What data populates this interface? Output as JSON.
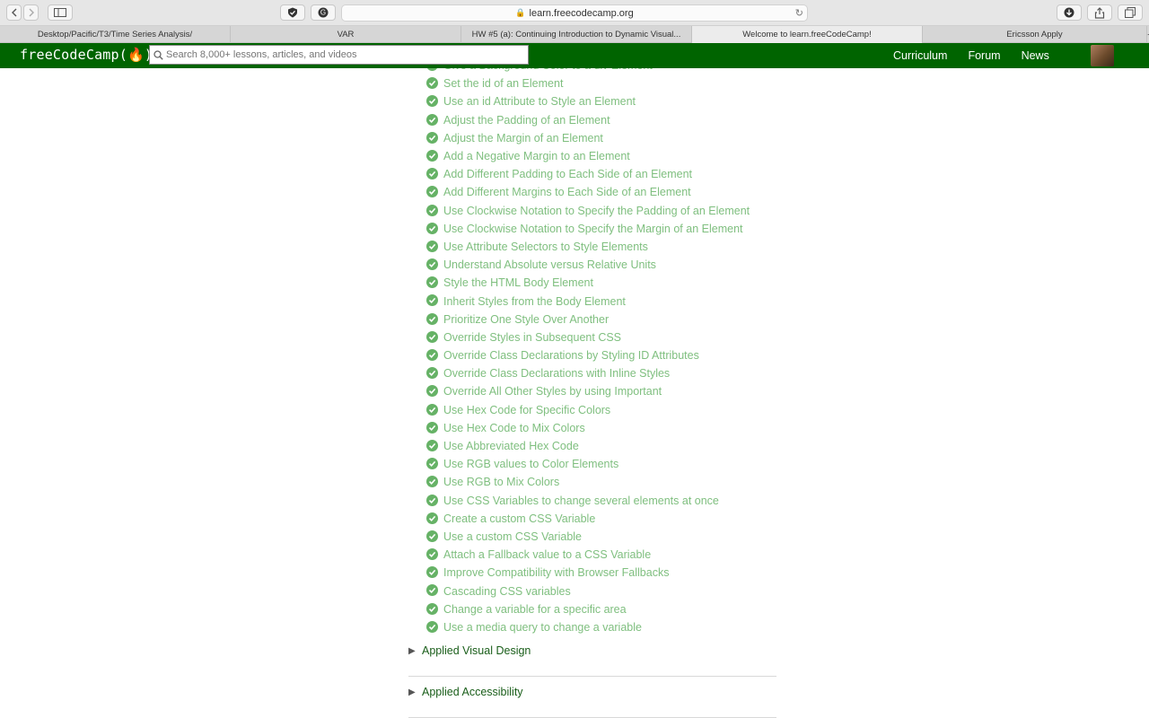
{
  "browser": {
    "url": "learn.freecodecamp.org",
    "tabs": [
      {
        "label": "Desktop/Pacific/T3/Time Series Analysis/",
        "active": false
      },
      {
        "label": "VAR",
        "active": false
      },
      {
        "label": "HW #5 (a): Continuing Introduction to Dynamic Visual...",
        "active": false
      },
      {
        "label": "Welcome to learn.freeCodeCamp!",
        "active": true
      },
      {
        "label": "Ericsson Apply",
        "active": false
      }
    ]
  },
  "nav": {
    "logo": "freeCodeCamp(🔥)",
    "search_placeholder": "Search 8,000+ lessons, articles, and videos",
    "links": [
      "Curriculum",
      "Forum",
      "News"
    ]
  },
  "lessons": [
    "Give a Background Color to a div Element",
    "Set the id of an Element",
    "Use an id Attribute to Style an Element",
    "Adjust the Padding of an Element",
    "Adjust the Margin of an Element",
    "Add a Negative Margin to an Element",
    "Add Different Padding to Each Side of an Element",
    "Add Different Margins to Each Side of an Element",
    "Use Clockwise Notation to Specify the Padding of an Element",
    "Use Clockwise Notation to Specify the Margin of an Element",
    "Use Attribute Selectors to Style Elements",
    "Understand Absolute versus Relative Units",
    "Style the HTML Body Element",
    "Inherit Styles from the Body Element",
    "Prioritize One Style Over Another",
    "Override Styles in Subsequent CSS",
    "Override Class Declarations by Styling ID Attributes",
    "Override Class Declarations with Inline Styles",
    "Override All Other Styles by using Important",
    "Use Hex Code for Specific Colors",
    "Use Hex Code to Mix Colors",
    "Use Abbreviated Hex Code",
    "Use RGB values to Color Elements",
    "Use RGB to Mix Colors",
    "Use CSS Variables to change several elements at once",
    "Create a custom CSS Variable",
    "Use a custom CSS Variable",
    "Attach a Fallback value to a CSS Variable",
    "Improve Compatibility with Browser Fallbacks",
    "Cascading CSS variables",
    "Change a variable for a specific area",
    "Use a media query to change a variable"
  ],
  "sections": [
    "Applied Visual Design",
    "Applied Accessibility"
  ],
  "colors": {
    "nav_bg": "#006400",
    "lesson_link": "#7fbf7f",
    "check": "#66b266",
    "section_label": "#1a5e1a"
  }
}
